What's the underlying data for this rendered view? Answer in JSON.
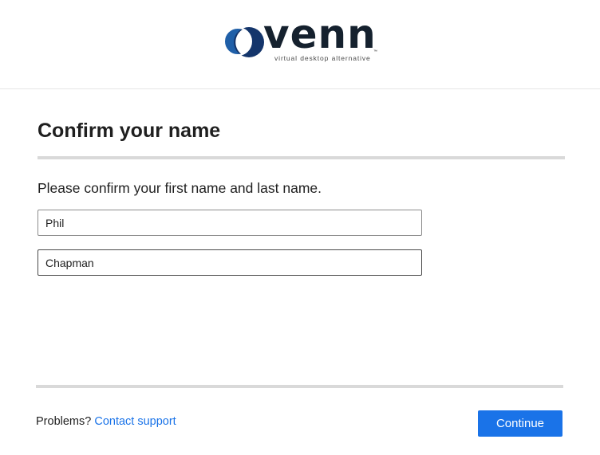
{
  "brand": {
    "wordmark": "venn",
    "tagline": "virtual desktop alternative",
    "trademark": "™",
    "colors": {
      "dark_navy": "#15212e",
      "blue": "#1f5fa8",
      "deep_blue": "#14356b"
    }
  },
  "page": {
    "title": "Confirm your name",
    "instructions": "Please confirm your first name and last name."
  },
  "form": {
    "first_name": {
      "value": "Phil",
      "placeholder": ""
    },
    "last_name": {
      "value": "Chapman",
      "placeholder": ""
    }
  },
  "footer": {
    "problems_label": "Problems?",
    "support_link": "Contact support",
    "continue_label": "Continue"
  },
  "colors": {
    "accent": "#1a73e8",
    "divider": "#d9d9d9",
    "text": "#1f1f1f"
  }
}
